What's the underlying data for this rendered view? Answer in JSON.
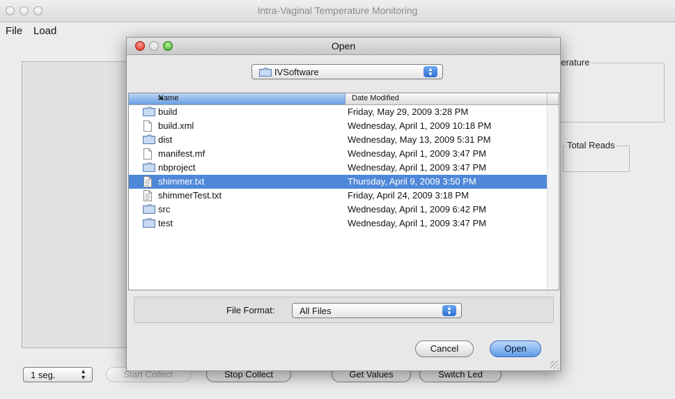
{
  "window": {
    "title": "Intra-Vaginal Temperature Monitoring"
  },
  "menubar": {
    "items": [
      "File",
      "Load"
    ]
  },
  "panels": {
    "temperature_label": " perature",
    "total_reads_label": "Total Reads"
  },
  "bottom_bar": {
    "segments_value": "1  seg.",
    "start_collect": "Start Collect",
    "stop_collect": "Stop Collect",
    "get_values": "Get Values",
    "switch_led": "Switch Led"
  },
  "dialog": {
    "title": "Open",
    "location": "IVSoftware",
    "columns": {
      "name": "Name",
      "date": "Date Modified"
    },
    "files": [
      {
        "name": "build",
        "type": "folder",
        "date": "Friday, May 29, 2009 3:28 PM"
      },
      {
        "name": "build.xml",
        "type": "file",
        "date": "Wednesday, April 1, 2009 10:18 PM"
      },
      {
        "name": "dist",
        "type": "folder",
        "date": "Wednesday, May 13, 2009 5:31 PM"
      },
      {
        "name": "manifest.mf",
        "type": "file",
        "date": "Wednesday, April 1, 2009 3:47 PM"
      },
      {
        "name": "nbproject",
        "type": "folder",
        "date": "Wednesday, April 1, 2009 3:47 PM"
      },
      {
        "name": "shimmer.txt",
        "type": "text",
        "date": "Thursday, April 9, 2009 3:50 PM",
        "selected": true
      },
      {
        "name": "shimmerTest.txt",
        "type": "text",
        "date": "Friday, April 24, 2009 3:18 PM"
      },
      {
        "name": "src",
        "type": "folder",
        "date": "Wednesday, April 1, 2009 6:42 PM"
      },
      {
        "name": "test",
        "type": "folder",
        "date": "Wednesday, April 1, 2009 3:47 PM"
      }
    ],
    "file_format_label": "File Format:",
    "file_format_value": "All Files",
    "cancel_label": "Cancel",
    "open_label": "Open"
  },
  "colors": {
    "selection": "#4f88d8",
    "default_button": "#5f9ae6"
  }
}
